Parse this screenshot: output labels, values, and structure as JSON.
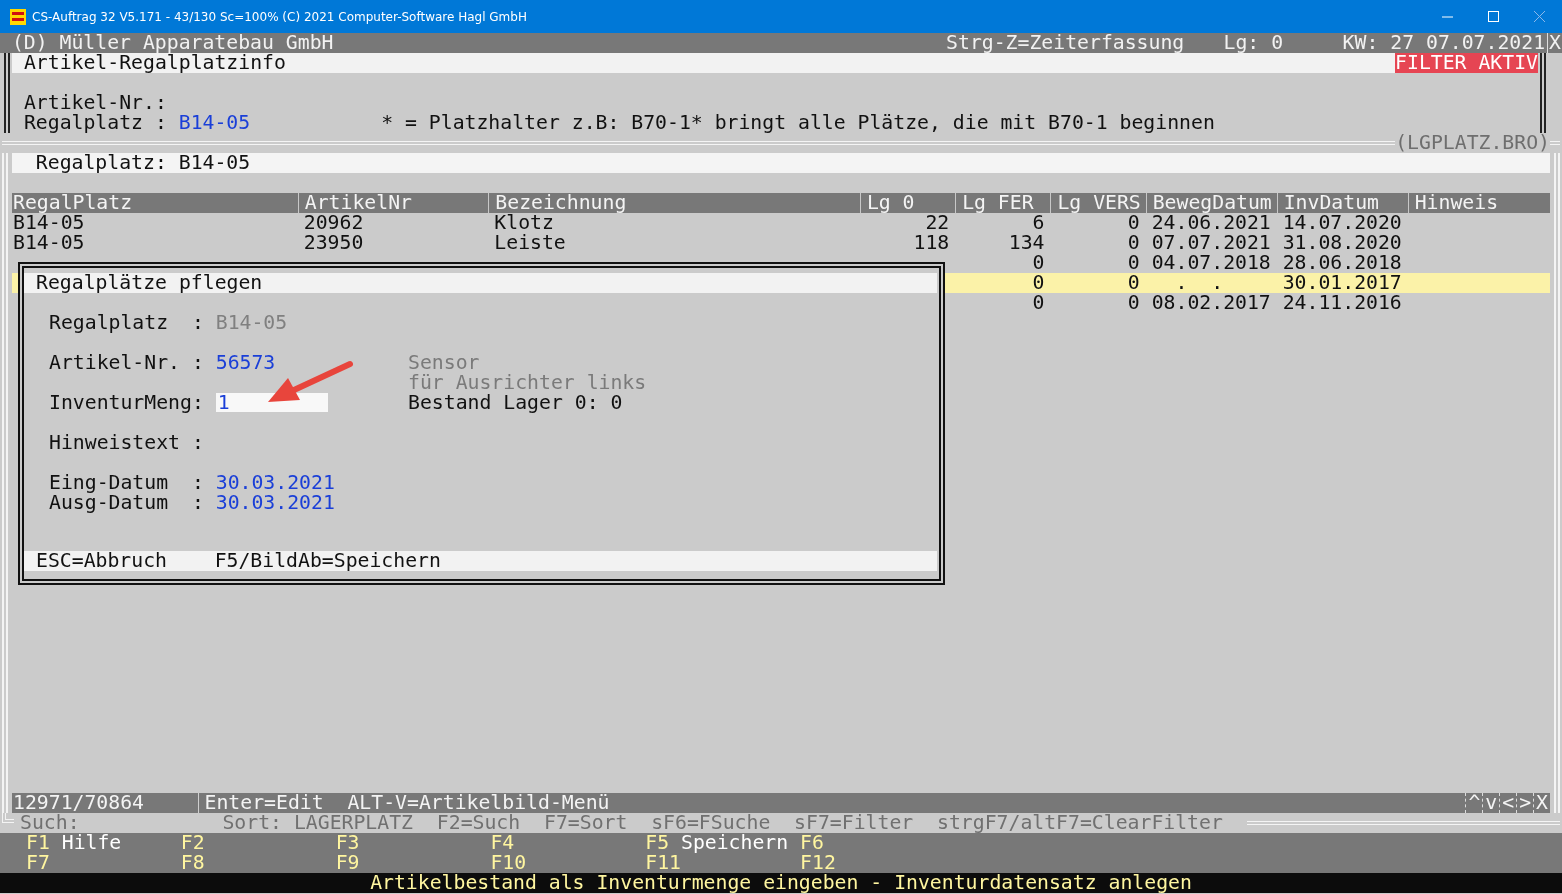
{
  "window": {
    "title": "CS-Auftrag 32 V5.171 - 43/130 Sc=100% (C) 2021 Computer-Software Hagl GmbH"
  },
  "header": {
    "company": "(D) Müller Apparatebau GmbH",
    "shortcut": "Strg-Z=Zeiterfassung",
    "storage": "Lg: 0",
    "date": "KW: 27 07.07.2021",
    "close": "X"
  },
  "search_panel": {
    "title": "Artikel-Regalplatzinfo",
    "filter_badge": "FILTER AKTIV",
    "fields": [
      {
        "label": "Artikel-Nr.:"
      },
      {
        "label": "Regalplatz :",
        "value": "B14-05",
        "hint": "* = Platzhalter z.B: B70-1* bringt alle Plätze, die mit B70-1 beginnen"
      }
    ],
    "frame_label": "(LGPLATZ.BRO)"
  },
  "list_panel": {
    "title": "Regalplatz: B14-05",
    "table": {
      "columns": [
        {
          "label": "RegalPlatz",
          "kind": "text"
        },
        {
          "label": "ArtikelNr",
          "kind": "text"
        },
        {
          "label": "Bezeichnung",
          "kind": "text"
        },
        {
          "label": "Lg 0",
          "kind": "number"
        },
        {
          "label": "Lg FER",
          "kind": "number"
        },
        {
          "label": "Lg VERS",
          "kind": "number"
        },
        {
          "label": "BewegDatum",
          "kind": "text"
        },
        {
          "label": "InvDatum",
          "kind": "text"
        },
        {
          "label": "Hinweis",
          "kind": "text"
        }
      ],
      "rows": [
        {
          "selected": false,
          "cells": [
            "B14-05",
            "20962",
            "Klotz",
            "22",
            "6",
            "0",
            "24.06.2021",
            "14.07.2020",
            null
          ]
        },
        {
          "selected": false,
          "cells": [
            "B14-05",
            "23950",
            "Leiste",
            "118",
            "134",
            "0",
            "07.07.2021",
            "31.08.2020",
            null
          ]
        },
        {
          "selected": false,
          "cells": [
            null,
            null,
            null,
            null,
            "0",
            "0",
            "04.07.2018",
            "28.06.2018",
            null
          ]
        },
        {
          "selected": true,
          "cells": [
            null,
            null,
            null,
            null,
            "0",
            "0",
            "  .  .",
            "30.01.2017",
            null
          ]
        },
        {
          "selected": false,
          "cells": [
            null,
            null,
            null,
            null,
            "0",
            "0",
            "08.02.2017",
            "24.11.2016",
            null
          ]
        }
      ]
    },
    "status_bar": {
      "count": "12971/70864",
      "hints": [
        "Enter=Edit",
        "ALT-V=Artikelbild-Menü"
      ],
      "nav": [
        "^",
        "v",
        "<",
        ">",
        "X"
      ]
    },
    "search_label": "Such:",
    "sort_hints": [
      "Sort: LAGERPLATZ",
      "F2=Such",
      "F7=Sort",
      "sF6=FSuche",
      "sF7=Filter",
      "strgF7/altF7=ClearFilter"
    ]
  },
  "dialog": {
    "title": "Regalplätze pflegen",
    "field_groups": [
      [
        {
          "label": "Regalplatz  :",
          "kind": "text",
          "value": "B14-05",
          "disabled": true
        }
      ],
      [
        {
          "label": "Artikel-Nr. :",
          "kind": "text",
          "value": "56573"
        }
      ],
      [
        {
          "label": "InventurMeng:",
          "kind": "input",
          "value": "1"
        }
      ],
      [
        {
          "label": "Hinweistext :",
          "kind": "text"
        }
      ],
      [
        {
          "label": "Eing-Datum  :",
          "kind": "text",
          "value": "30.03.2021"
        },
        {
          "label": "Ausg-Datum  :",
          "kind": "text",
          "value": "30.03.2021"
        }
      ]
    ],
    "info": [
      {
        "text": "Sensor",
        "dim": true
      },
      {
        "text": "für Ausrichter links",
        "dim": true
      },
      {
        "text": "Bestand Lager 0: 0",
        "dim": false
      }
    ],
    "footer": [
      "ESC=Abbruch",
      "F5/BildAb=Speichern"
    ]
  },
  "function_keys": [
    [
      {
        "key": "F1",
        "label": "Hilfe"
      },
      {
        "key": "F2"
      },
      {
        "key": "F3"
      },
      {
        "key": "F4"
      },
      {
        "key": "F5",
        "label": "Speichern"
      },
      {
        "key": "F6"
      }
    ],
    [
      {
        "key": "F7"
      },
      {
        "key": "F8"
      },
      {
        "key": "F9"
      },
      {
        "key": "F10"
      },
      {
        "key": "F11"
      },
      {
        "key": "F12"
      }
    ]
  ],
  "message": "Artikelbestand als Inventurmenge eingeben - Inventurdatensatz anlegen"
}
